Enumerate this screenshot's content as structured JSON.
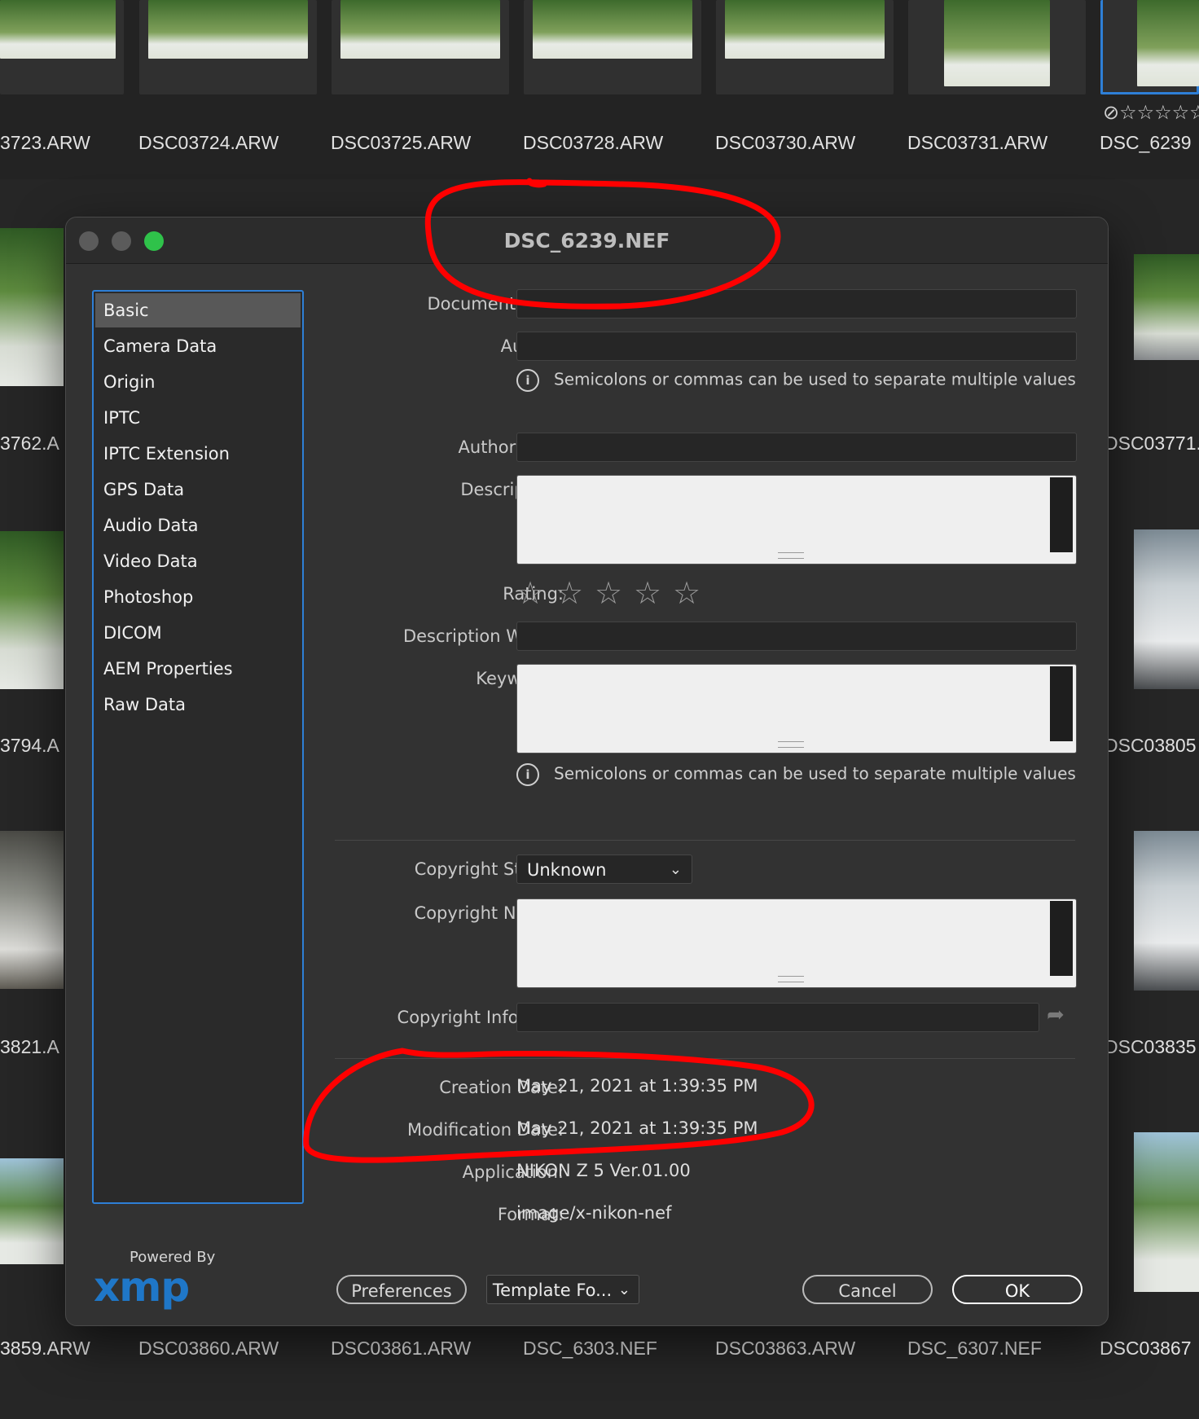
{
  "browser": {
    "top_row": [
      "3723.ARW",
      "DSC03724.ARW",
      "DSC03725.ARW",
      "DSC03728.ARW",
      "DSC03730.ARW",
      "DSC03731.ARW",
      "DSC_6239"
    ],
    "bottom_row": [
      "3859.ARW",
      "DSC03860.ARW",
      "DSC03861.ARW",
      "DSC_6303.NEF",
      "DSC03863.ARW",
      "DSC_6307.NEF",
      "DSC03867"
    ],
    "left_names": [
      "3762.A",
      "3794.A",
      "3821.A"
    ],
    "right_names": [
      "DSC03771.",
      "DSC03805",
      "DSC03835"
    ],
    "selected_rating": {
      "reject": "⊘",
      "stars": "☆☆☆☆☆"
    }
  },
  "dialog": {
    "title": "DSC_6239.NEF",
    "colors": {
      "close": "#5b5b5b",
      "minimize": "#5b5b5b",
      "zoom": "#2fc24a",
      "accent": "#2e7fd6",
      "annotation": "#ff0000"
    },
    "sidebar": [
      {
        "label": "Basic",
        "active": true
      },
      {
        "label": "Camera Data"
      },
      {
        "label": "Origin"
      },
      {
        "label": "IPTC"
      },
      {
        "label": "IPTC Extension"
      },
      {
        "label": "GPS Data"
      },
      {
        "label": "Audio Data"
      },
      {
        "label": "Video Data"
      },
      {
        "label": "Photoshop"
      },
      {
        "label": "DICOM"
      },
      {
        "label": "AEM Properties"
      },
      {
        "label": "Raw Data"
      }
    ],
    "fields": {
      "document_title": {
        "label": "Document Title:",
        "value": ""
      },
      "author": {
        "label": "Author:",
        "value": ""
      },
      "hint": "Semicolons or commas can be used to separate multiple values",
      "author_title": {
        "label": "Author Title:",
        "value": ""
      },
      "description": {
        "label": "Description:",
        "value": ""
      },
      "rating": {
        "label": "Rating:",
        "stars": 0,
        "max": 5
      },
      "description_writer": {
        "label": "Description Writer:",
        "value": ""
      },
      "keywords": {
        "label": "Keywords:",
        "value": ""
      },
      "copyright_status": {
        "label": "Copyright Status:",
        "value": "Unknown"
      },
      "copyright_notice": {
        "label": "Copyright Notice:",
        "value": ""
      },
      "copyright_url": {
        "label": "Copyright Info URL:",
        "value": ""
      },
      "creation_date": {
        "label": "Creation Date:",
        "value": "May 21, 2021 at 1:39:35 PM"
      },
      "modification_date": {
        "label": "Modification Date:",
        "value": "May 21, 2021 at 1:39:35 PM"
      },
      "application": {
        "label": "Application:",
        "value": "NIKON Z 5 Ver.01.00"
      },
      "format": {
        "label": "Format:",
        "value": "image/x-nikon-nef"
      }
    },
    "footer": {
      "powered_by": "Powered By",
      "logo": "xmp",
      "preferences": "Preferences",
      "template": "Template Fo...",
      "cancel": "Cancel",
      "ok": "OK"
    }
  }
}
